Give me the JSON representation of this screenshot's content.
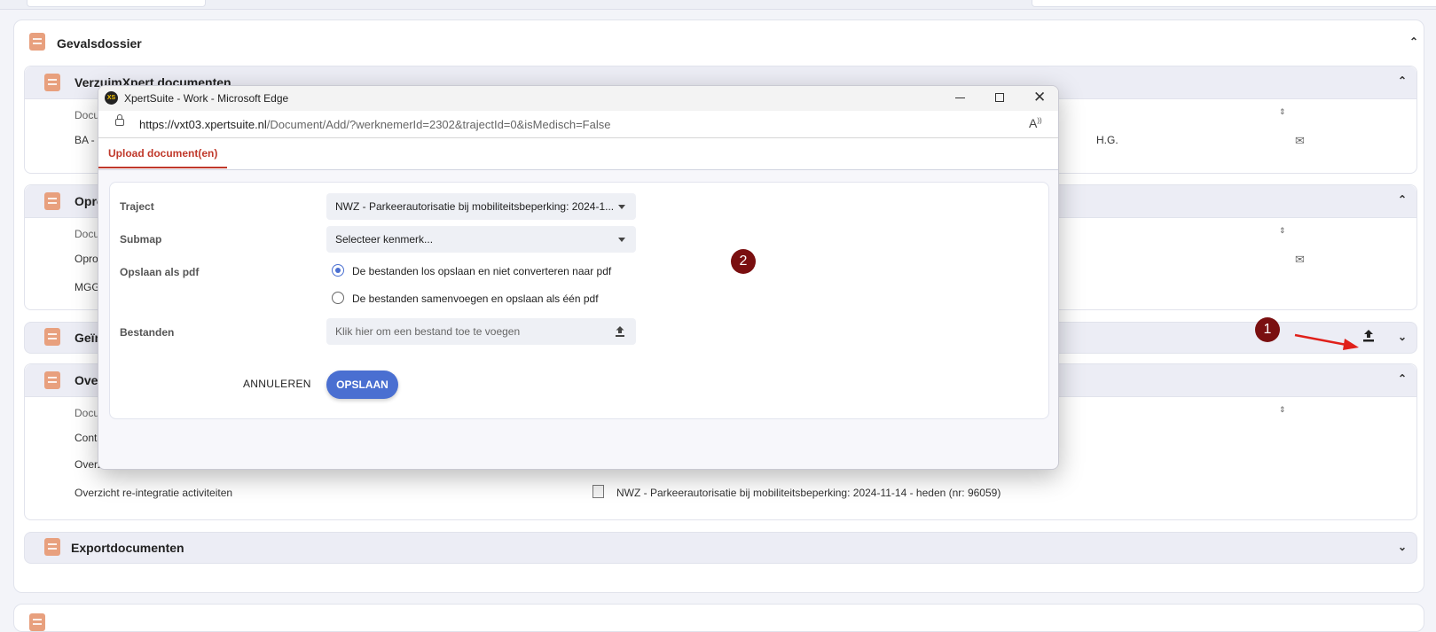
{
  "page": {
    "main_title": "Gevalsdossier",
    "sections": {
      "verzuim": "VerzuimXpert documenten",
      "opro": "Opro",
      "gei": "Geïn",
      "over": "Over",
      "export": "Exportdocumenten"
    },
    "rows": {
      "docu_1": "Docu",
      "ba": "BA - \\",
      "hg": "H.G.",
      "docu_2": "Docu",
      "oproc": "Oproc",
      "mgg": "MGG",
      "docu_3": "Docu",
      "conta": "Conta",
      "overz": "Overz",
      "reint": "Overzicht re-integratie activiteiten",
      "reint_traject": "NWZ - Parkeerautorisatie bij mobiliteitsbeperking: 2024-11-14 - heden (nr: 96059)"
    }
  },
  "popup": {
    "window_title": "XpertSuite - Work - Microsoft Edge",
    "url_host": "https://vxt03.xpertsuite.nl",
    "url_path": "/Document/Add/?werknemerId=2302&trajectId=0&isMedisch=False",
    "tab_label": "Upload document(en)",
    "form": {
      "traject_label": "Traject",
      "traject_value": "NWZ - Parkeerautorisatie bij mobiliteitsbeperking: 2024-1...",
      "submap_label": "Submap",
      "submap_value": "Selecteer kenmerk...",
      "pdf_label": "Opslaan als pdf",
      "pdf_option_1": "De bestanden los opslaan en niet converteren naar pdf",
      "pdf_option_2": "De bestanden samenvoegen en opslaan als één pdf",
      "pdf_selected": 1,
      "files_label": "Bestanden",
      "files_placeholder": "Klik hier om een bestand toe te voegen",
      "cancel_label": "ANNULEREN",
      "save_label": "OPSLAAN"
    }
  },
  "annotations": {
    "badge_1": "1",
    "badge_2": "2"
  },
  "colors": {
    "accent_blue": "#4a6fd1",
    "tab_red": "#c0392b",
    "badge": "#7a0f10",
    "arrow": "#e0201a",
    "doc_icon": "#e8a07e"
  }
}
